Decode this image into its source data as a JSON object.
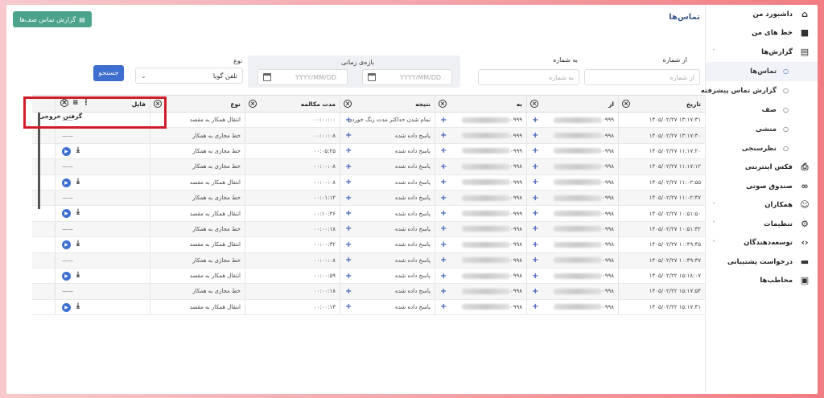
{
  "header": {
    "title": "تماس‌ها",
    "report_button": "گزارش تماس صف‌ها"
  },
  "sidebar": {
    "items": [
      {
        "label": "داشبورد من",
        "icon": "home-icon"
      },
      {
        "label": "خط های من",
        "icon": "sim-card-icon"
      },
      {
        "label": "گزارش‌ها",
        "icon": "report-icon",
        "expanded": true
      },
      {
        "label": "فکس اینترنتی",
        "icon": "fax-icon"
      },
      {
        "label": "صندوق صوتی",
        "icon": "voicemail-icon"
      },
      {
        "label": "همکاران",
        "icon": "users-icon"
      },
      {
        "label": "تنظیمات",
        "icon": "gear-icon"
      },
      {
        "label": "توسعه‌دهندگان",
        "icon": "code-icon"
      },
      {
        "label": "درخواست پشتیبانی",
        "icon": "ticket-icon"
      },
      {
        "label": "مخاطب‌ها",
        "icon": "contacts-icon"
      }
    ],
    "sub_items": [
      {
        "label": "تماس‌ها",
        "active": true
      },
      {
        "label": "گزارش تماس پیشرفته",
        "active": false
      },
      {
        "label": "صف",
        "active": false
      },
      {
        "label": "منشی",
        "active": false
      },
      {
        "label": "نظرسنجی",
        "active": false
      }
    ]
  },
  "filters": {
    "from_label": "از شماره",
    "from_placeholder": "از شماره",
    "to_label": "به شماره",
    "to_placeholder": "به شماره",
    "period_label": "بازه‌ی زمانی",
    "date_placeholder": "YYYY/MM/DD",
    "type_label": "نوع",
    "type_value": "تلفن گویا",
    "search_button": "جستجو"
  },
  "table": {
    "columns": [
      "تاریخ",
      "از",
      "به",
      "نتیجه",
      "مدت مکالمه",
      "نوع",
      "فایل"
    ],
    "file_cell_label": "گرفتن خروجی",
    "rows": [
      {
        "date": "۱۴۰۵/۰۲/۲۷ ۱۳:۱۷:۳۱",
        "from": "۰۹۹۹",
        "to": "۰۹۹۹",
        "result": "تمام شدن حداکثر مدت زنگ خوردن",
        "duration": "۰۰:۰۰:۰۰",
        "type": "انتقال همکار به مقصد",
        "file": "dash"
      },
      {
        "date": "۱۴۰۵/۰۲/۲۷ ۱۳:۱۷:۳۰",
        "from": "۰۹۹۸",
        "to": "۰۹۹۹",
        "result": "پاسخ داده شده",
        "duration": "۰۰:۰۰:۰۸",
        "type": "خط مجازی به همکار",
        "file": "dash"
      },
      {
        "date": "۱۴۰۵/۰۲/۲۷ ۱۱:۱۷:۲۰",
        "from": "۰۹۹۸",
        "to": "۰۹۹۹",
        "result": "پاسخ داده شده",
        "duration": "۰۰:۰۵:۲۵",
        "type": "خط مجازی به همکار",
        "file": "audio"
      },
      {
        "date": "۱۴۰۵/۰۲/۲۷ ۱۱:۱۷:۱۲",
        "from": "۰۹۹۸",
        "to": "۰۹۹۸",
        "result": "پاسخ داده شده",
        "duration": "۰۰:۰۰:۰۸",
        "type": "خط مجازی به همکار",
        "file": "dash"
      },
      {
        "date": "۱۴۰۵/۰۲/۲۷ ۱۱:۰۲:۵۵",
        "from": "۰۹۹۸",
        "to": "۰۹۹۹",
        "result": "پاسخ داده شده",
        "duration": "۰۰:۰۰:۰۸",
        "type": "انتقال همکار به مقصد",
        "file": "audio"
      },
      {
        "date": "۱۴۰۵/۰۲/۲۷ ۱۱:۰۲:۴۷",
        "from": "۰۹۹۸",
        "to": "۰۹۹۸",
        "result": "پاسخ داده شده",
        "duration": "۰۰:۰۱:۱۲",
        "type": "خط مجازی به همکار",
        "file": "dash"
      },
      {
        "date": "۱۴۰۵/۰۲/۲۷ ۱۰:۵۱:۵۰",
        "from": "۰۹۹۸",
        "to": "۰۹۹۹",
        "result": "پاسخ داده شده",
        "duration": "۰۰:۱۰:۴۶",
        "type": "انتقال همکار به مقصد",
        "file": "audio"
      },
      {
        "date": "۱۴۰۵/۰۲/۲۷ ۱۰:۵۱:۳۲",
        "from": "۰۹۹۸",
        "to": "۰۹۹۸",
        "result": "پاسخ داده شده",
        "duration": "۰۰:۰۰:۱۸",
        "type": "خط مجازی به همکار",
        "file": "dash"
      },
      {
        "date": "۱۴۰۵/۰۲/۲۷ ۱۰:۴۹:۴۵",
        "from": "۰۹۹۸",
        "to": "۰۹۹۸",
        "result": "پاسخ داده شده",
        "duration": "۰۰:۰۰:۳۲",
        "type": "انتقال همکار به مقصد",
        "file": "audio"
      },
      {
        "date": "۱۴۰۵/۰۲/۲۷ ۱۰:۴۹:۳۷",
        "from": "۰۹۹۸",
        "to": "۰۹۹۸",
        "result": "پاسخ داده شده",
        "duration": "۰۰:۰۰:۰۸",
        "type": "خط مجازی به همکار",
        "file": "dash"
      },
      {
        "date": "۱۴۰۵/۰۲/۲۲ ۱۵:۱۸:۰۷",
        "from": "۰۹۹۸",
        "to": "۰۹۹۸",
        "result": "پاسخ داده شده",
        "duration": "۰۰:۰۰:۵۹",
        "type": "انتقال همکار به مقصد",
        "file": "audio"
      },
      {
        "date": "۱۴۰۵/۰۲/۲۲ ۱۵:۱۷:۵۴",
        "from": "۰۹۹۸",
        "to": "۰۹۹۸",
        "result": "پاسخ داده شده",
        "duration": "۰۰:۰۰:۱۸",
        "type": "خط مجازی به همکار",
        "file": "dash"
      },
      {
        "date": "۱۴۰۵/۰۲/۲۲ ۱۵:۱۷:۴۱",
        "from": "۰۹۹۸",
        "to": "۰۹۹۸",
        "result": "پاسخ داده شده",
        "duration": "۰۰:۰۰:۱۳",
        "type": "انتقال همکار به مقصد",
        "file": "audio"
      }
    ]
  },
  "colors": {
    "accent": "#3c6fcf",
    "report_button": "#4aa38a",
    "highlight": "#d11d2a"
  }
}
